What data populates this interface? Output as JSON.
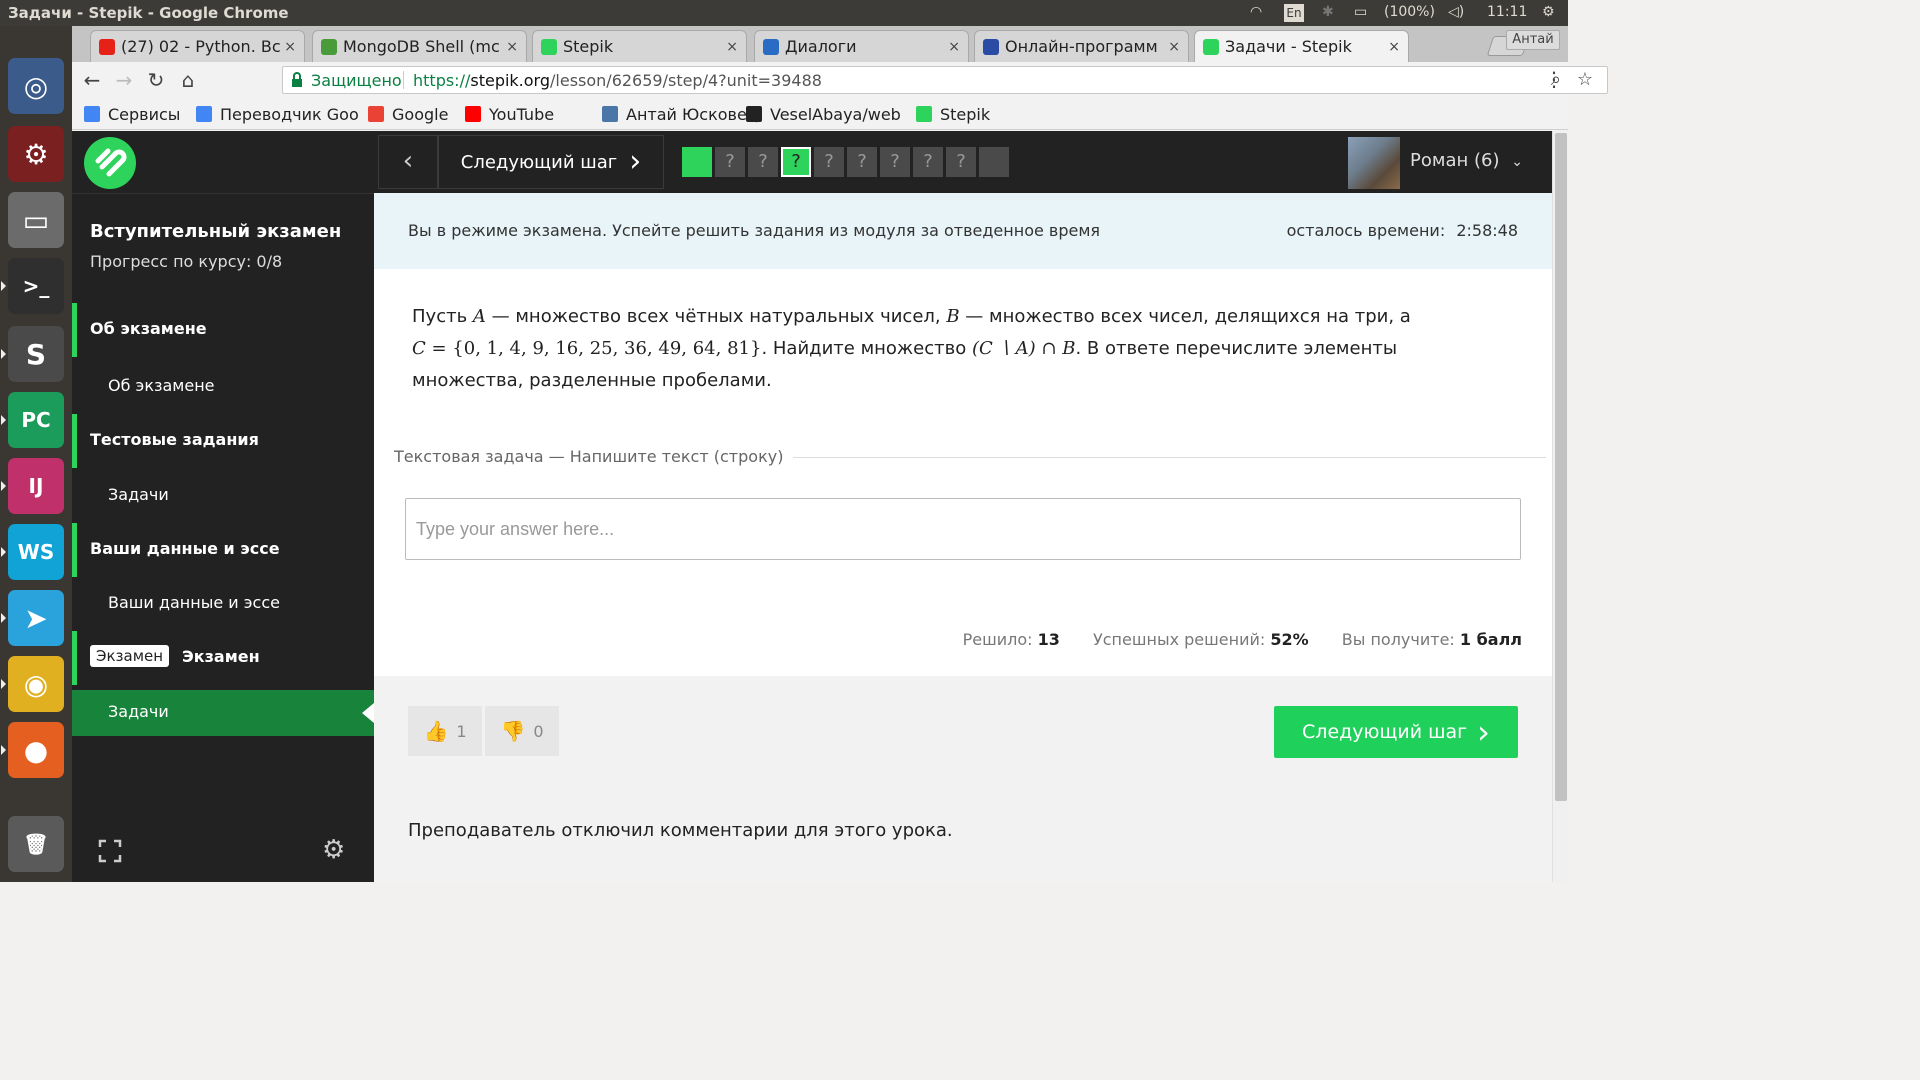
{
  "panel": {
    "window_title": "Задачи - Stepik - Google Chrome",
    "lang": "En",
    "battery": "(100%)",
    "clock": "11:11"
  },
  "launcher": {
    "apps": [
      {
        "name": "ubuntu-dash",
        "glyph": "◎",
        "color": "#3b5c8a"
      },
      {
        "name": "system-settings",
        "glyph": "⚙",
        "color": "#7a2020"
      },
      {
        "name": "files",
        "glyph": "▭",
        "color": "#6b6b6b"
      },
      {
        "name": "terminal",
        "glyph": ">_",
        "color": "#2f2f2f"
      },
      {
        "name": "sublime-text",
        "glyph": "S",
        "color": "#4a4a4a"
      },
      {
        "name": "pycharm",
        "glyph": "PC",
        "color": "#1c9c5a"
      },
      {
        "name": "intellij",
        "glyph": "IJ",
        "color": "#c0306a"
      },
      {
        "name": "webstorm",
        "glyph": "WS",
        "color": "#12a3d6"
      },
      {
        "name": "telegram",
        "glyph": "➤",
        "color": "#2aa3dd"
      },
      {
        "name": "chrome",
        "glyph": "◉",
        "color": "#e0b020"
      },
      {
        "name": "firefox",
        "glyph": "●",
        "color": "#e56020"
      },
      {
        "name": "trash",
        "glyph": "🗑",
        "color": "#5a5a5a"
      }
    ]
  },
  "tabs": [
    {
      "title": "(27) 02 - Python. Bc",
      "favicon_color": "#e62117",
      "close": "×"
    },
    {
      "title": "MongoDB Shell (mc",
      "favicon_color": "#4a9c3a",
      "close": "×"
    },
    {
      "title": "Stepik",
      "favicon_color": "#2dd35a",
      "close": "×"
    },
    {
      "title": "Диалоги",
      "favicon_color": "#2a6cc4",
      "close": "×"
    },
    {
      "title": "Онлайн-программ",
      "favicon_color": "#2a4ca4",
      "close": "×"
    },
    {
      "title": "Задачи - Stepik",
      "favicon_color": "#2dd35a",
      "close": "×"
    }
  ],
  "profile_label": "Антай",
  "omnibox": {
    "secure_label": "Защищено",
    "url_scheme": "https://",
    "url_host": "stepik.org",
    "url_path": "/lesson/62659/step/4?unit=39488"
  },
  "bookmarks": [
    {
      "label": "Сервисы",
      "icon_color": "#4285f4"
    },
    {
      "label": "Переводчик Goo",
      "icon_color": "#4285f4"
    },
    {
      "label": "Google",
      "icon_color": "#ea4335"
    },
    {
      "label": "YouTube",
      "icon_color": "#ff0000"
    },
    {
      "label": "Антай Юсковец",
      "icon_color": "#4a76a8"
    },
    {
      "label": "VeselAbaya/web",
      "icon_color": "#222222"
    },
    {
      "label": "Stepik",
      "icon_color": "#2dd35a"
    }
  ],
  "sidebar": {
    "course_title": "Вступительный экзамен",
    "progress": "Прогресс по курсу: 0/8",
    "sections": [
      {
        "title": "Об экзамене",
        "item": "Об экзамене"
      },
      {
        "title": "Тестовые задания",
        "item": "Задачи"
      },
      {
        "title": "Ваши данные и эссе",
        "item": "Ваши данные и эссе"
      },
      {
        "badge": "Экзамен",
        "title": "Экзамен",
        "item": "Задачи"
      }
    ]
  },
  "header": {
    "next_step_label": "Следующий шаг",
    "steps": [
      "",
      "?",
      "?",
      "?",
      "?",
      "?",
      "?",
      "?",
      "?",
      ""
    ],
    "user_name": "Роман (6)"
  },
  "notice": {
    "text": "Вы в режиме экзамена. Успейте решить задания из модуля за отведенное время",
    "time_label": "осталось времени:",
    "time_value": "2:58:48"
  },
  "question": {
    "p1": "Пусть ",
    "A": "A",
    "p2": " — множество всех чётных натуральных чисел, ",
    "B": "B",
    "p3": " — множество всех чисел, делящихся на три, а",
    "C": "C",
    "set": " = {0, 1, 4, 9, 16, 25, 36, 49, 64, 81}",
    "p4": ". Найдите множество ",
    "expr": "(C ∖ A) ∩ B",
    "p5": ". В ответе перечислите элементы множества, разделенные пробелами."
  },
  "task": {
    "type_label": "Текстовая задача — Напишите текст (строку)",
    "placeholder": "Type your answer here..."
  },
  "stats": {
    "solved_label": "Решило:",
    "solved_value": "13",
    "success_label": "Успешных решений:",
    "success_value": "52%",
    "reward_label": "Вы получите:",
    "reward_value": "1 балл"
  },
  "footer": {
    "likes": "1",
    "dislikes": "0",
    "next_step_label": "Следующий шаг",
    "comments_disabled": "Преподаватель отключил комментарии для этого урока."
  }
}
